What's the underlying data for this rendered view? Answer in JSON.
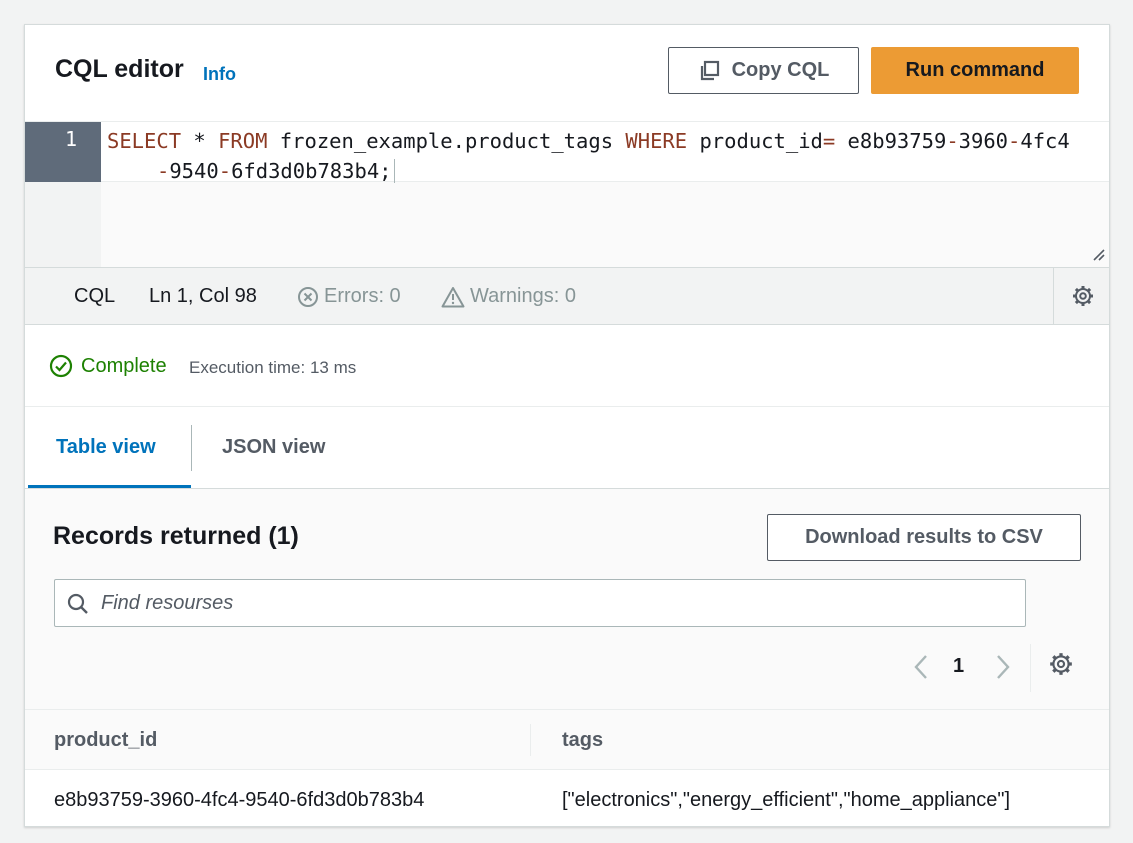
{
  "header": {
    "title": "CQL editor",
    "info_label": "Info",
    "copy_label": "Copy CQL",
    "run_label": "Run command"
  },
  "editor": {
    "line_number": "1",
    "code": {
      "kw_select": "SELECT",
      "star": " * ",
      "kw_from": "FROM",
      "table": " frozen_example.product_tags ",
      "kw_where": "WHERE",
      "column": " product_id",
      "eq": "=",
      "uuid_p1": " e8b93759",
      "dash1": "-",
      "uuid_p2": "3960",
      "dash2": "-",
      "uuid_p3": "4fc4",
      "dash3": "-",
      "uuid_p4": "9540",
      "dash4": "-",
      "uuid_p5": "6fd3d0b783b4;"
    }
  },
  "statusbar": {
    "language": "CQL",
    "position": "Ln 1, Col 98",
    "errors": "Errors: 0",
    "warnings": "Warnings: 0"
  },
  "execution": {
    "status": "Complete",
    "time": "Execution time: 13 ms"
  },
  "tabs": [
    {
      "label": "Table view",
      "active": true
    },
    {
      "label": "JSON view",
      "active": false
    }
  ],
  "results": {
    "title": "Records returned (1)",
    "download_label": "Download results to CSV",
    "search_placeholder": "Find resourses",
    "page": "1",
    "columns": [
      "product_id",
      "tags"
    ],
    "rows": [
      [
        "e8b93759-3960-4fc4-9540-6fd3d0b783b4",
        "[\"electronics\",\"energy_efficient\",\"home_appliance\"]"
      ]
    ]
  },
  "colors": {
    "accent": "#0073bb",
    "primary_button": "#ec9b34",
    "success": "#1d8102"
  }
}
